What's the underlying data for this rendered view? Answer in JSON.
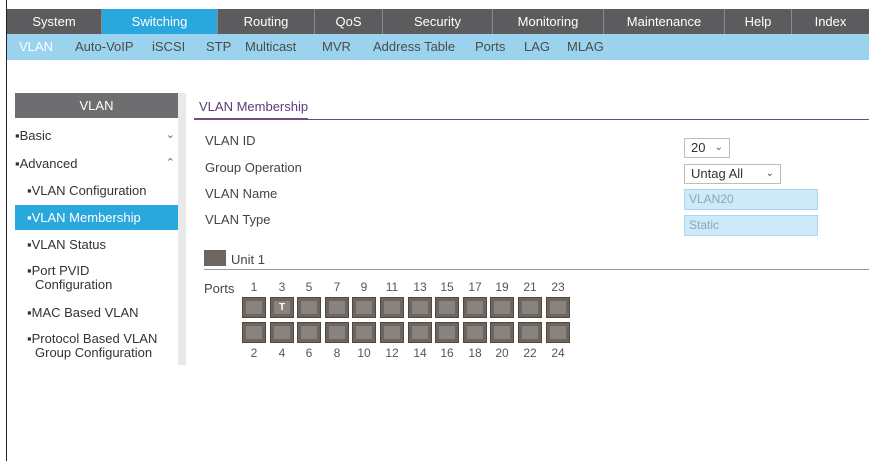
{
  "topnav": [
    "System",
    "Switching",
    "Routing",
    "QoS",
    "Security",
    "Monitoring",
    "Maintenance",
    "Help",
    "Index"
  ],
  "topnav_active": "Switching",
  "subnav": [
    "VLAN",
    "Auto-VoIP",
    "iSCSI",
    "STP",
    "Multicast",
    "MVR",
    "Address Table",
    "Ports",
    "LAG",
    "MLAG"
  ],
  "subnav_active": "VLAN",
  "sidebar": {
    "header": "VLAN",
    "basic": "Basic",
    "advanced": "Advanced",
    "items": [
      "VLAN Configuration",
      "VLAN Membership",
      "VLAN Status",
      "Port PVID",
      "Configuration",
      "MAC Based VLAN",
      "Protocol Based VLAN",
      "Group Configuration"
    ],
    "active": "VLAN Membership"
  },
  "main": {
    "title": "VLAN Membership",
    "vlan_id_label": "VLAN ID",
    "vlan_id_value": "20",
    "group_operation_label": "Group Operation",
    "group_operation_value": "Untag All",
    "vlan_name_label": "VLAN Name",
    "vlan_name_value": "VLAN20",
    "vlan_type_label": "VLAN Type",
    "vlan_type_value": "Static",
    "unit_label": "Unit 1",
    "ports_label": "Ports",
    "top_ports": [
      "1",
      "3",
      "5",
      "7",
      "9",
      "11",
      "13",
      "15",
      "17",
      "19",
      "21",
      "23"
    ],
    "bottom_ports": [
      "2",
      "4",
      "6",
      "8",
      "10",
      "12",
      "14",
      "16",
      "18",
      "20",
      "22",
      "24"
    ],
    "port_marks": {
      "3": "T"
    }
  },
  "colors": {
    "accent": "#29a8dd",
    "nav_bg": "#5c5c5e",
    "subnav_bg": "#9bd3ef",
    "title_color": "#5b3a7a",
    "port_color": "#6d6560"
  }
}
